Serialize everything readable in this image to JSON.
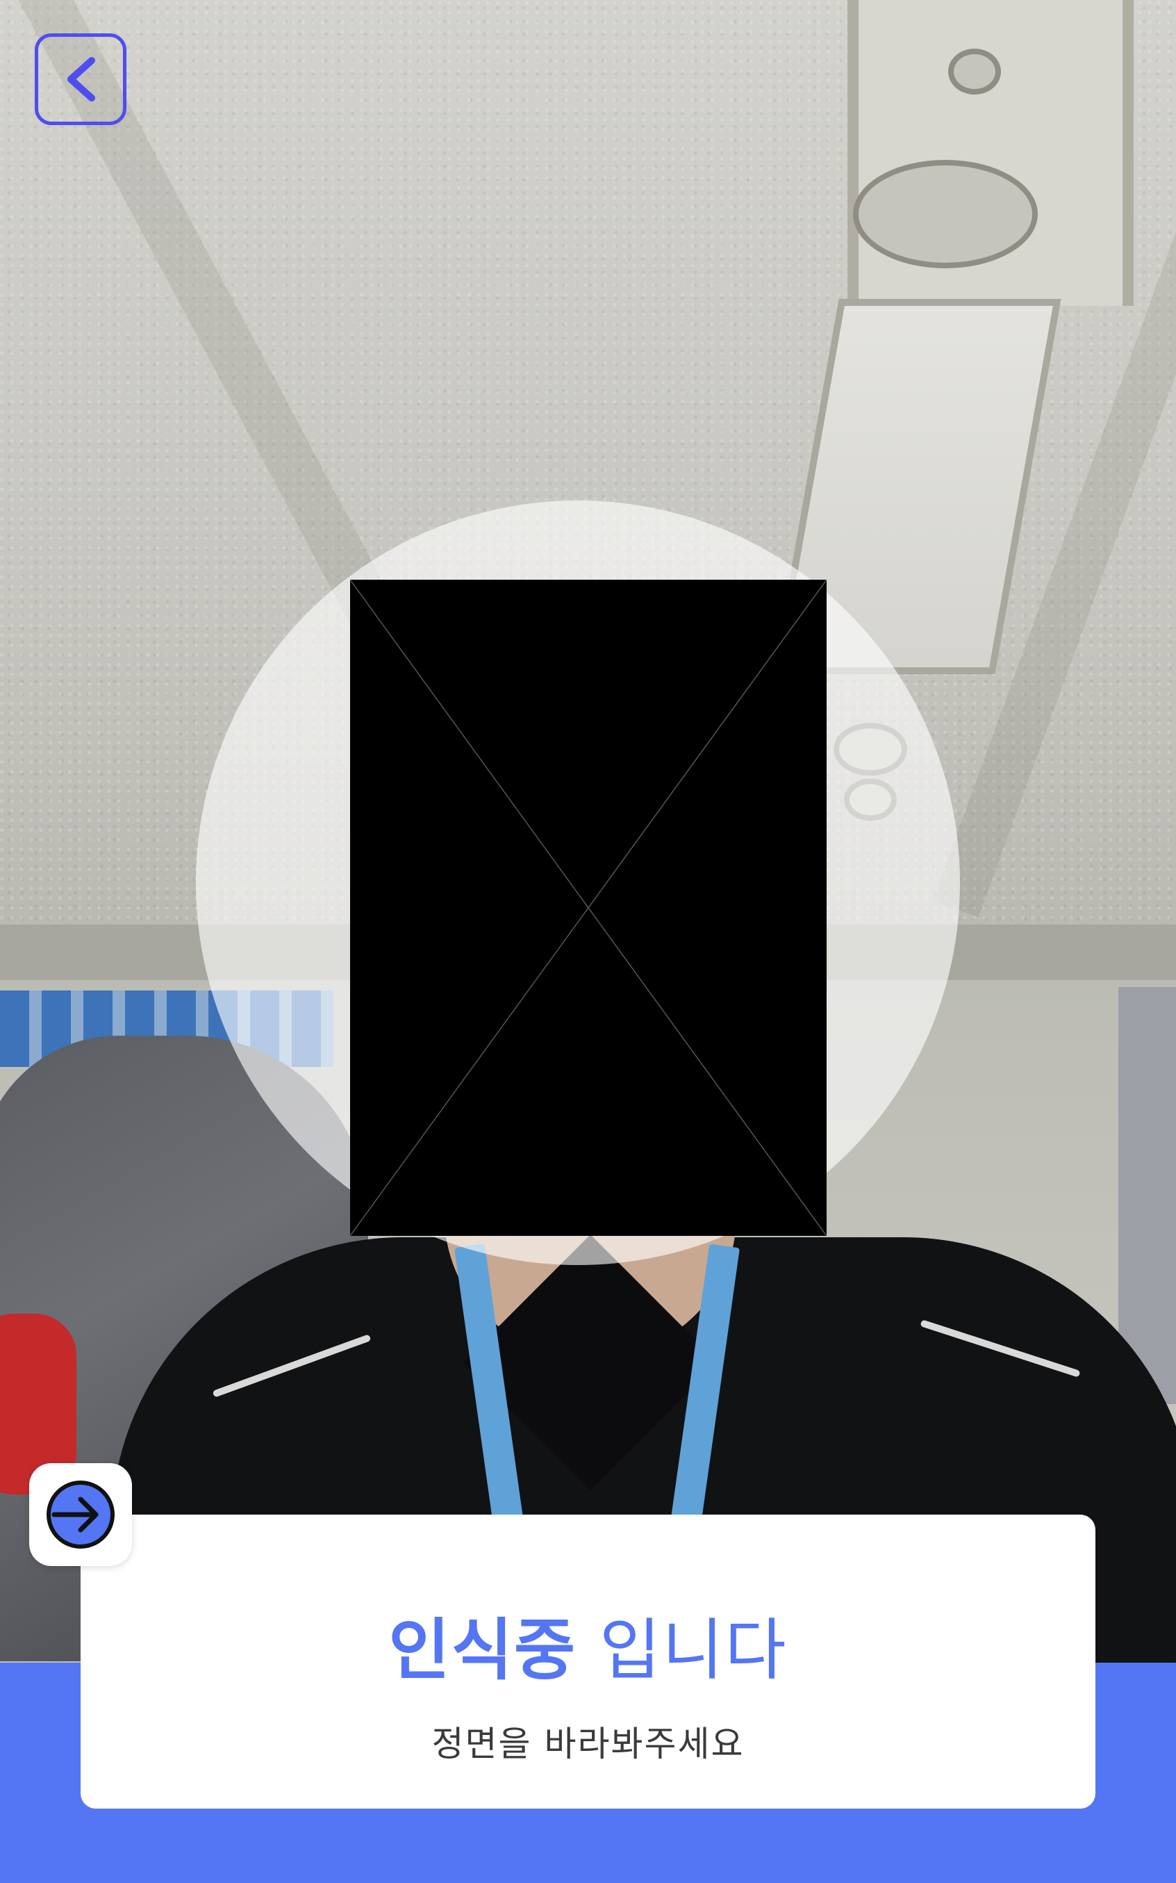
{
  "screen": {
    "status_title_strong": "인식중",
    "status_title_rest": "입니다",
    "status_subtitle": "정면을 바라봐주세요"
  },
  "colors": {
    "accent": "#5476F4",
    "back_button_border": "#4E4EF0",
    "card_background": "#FFFFFF",
    "subtitle_text": "#3A3A3A"
  },
  "icons": {
    "back": "chevron-left-icon",
    "enter": "arrow-right-circle-icon"
  }
}
